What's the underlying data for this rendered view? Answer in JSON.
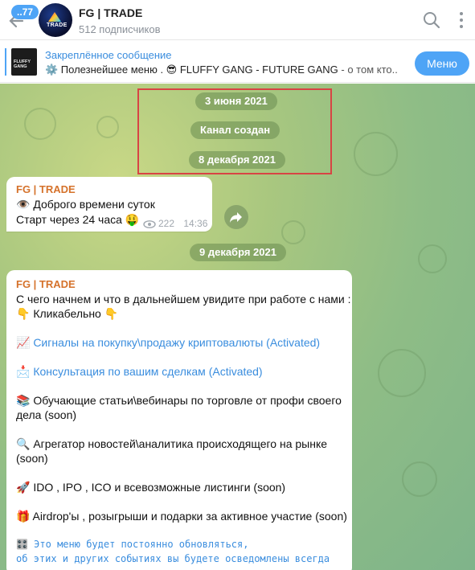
{
  "header": {
    "unread_count": "..77",
    "avatar_label": "TRADE",
    "title": "FG | TRADE",
    "subscribers": "512 подписчиков"
  },
  "pinned": {
    "thumb_label": "FLUFFY GANG",
    "title": "Закреплённое сообщение",
    "text": "⚙️ Полезнейшее меню .  😎 FLUFFY GANG - FUTURE GANG",
    "text_tail": " - о том кто...",
    "button": "Меню"
  },
  "dates": {
    "d1": "3 июня 2021",
    "service": "Канал создан",
    "d2": "8 декабря 2021",
    "d3": "9 декабря 2021"
  },
  "message1": {
    "sender": "FG | TRADE",
    "line1": "👁️ Доброго времени суток",
    "line2": "Старт через 24 часа 🤑",
    "views": "222",
    "time": "14:36"
  },
  "message2": {
    "sender": "FG | TRADE",
    "intro": "С чего начнем и что в дальнейшем увидите при работе с нами :",
    "click": "👇 Кликабельно 👇",
    "item1": "📈 Сигналы на покупку\\продажу криптовалюты (Activated)",
    "item2": "📩 Консультация по вашим сделкам (Activated)",
    "item3a": "📚 Обучающие статьи\\вебинары по торговле от профи своего",
    "item3b": "дела (soon)",
    "item4a": "🔍 Агрегатор новостей\\аналитика происходящего на рынке",
    "item4b": "(soon)",
    "item5": "🚀  IDO , IPO , ICO и всевозможные листинги (soon)",
    "item6": "🎁 Airdrop'ы , розыгрыши и подарки за активное участие (soon)",
    "item7a": "🎛️ Это меню будет постоянно обновляться,",
    "item7b": "об этих и других событиях вы будете осведомлены всегда"
  },
  "colors": {
    "accent": "#4ea4f6",
    "sender": "#d5722b",
    "link": "#3a8dde",
    "highlight": "#d84444"
  }
}
